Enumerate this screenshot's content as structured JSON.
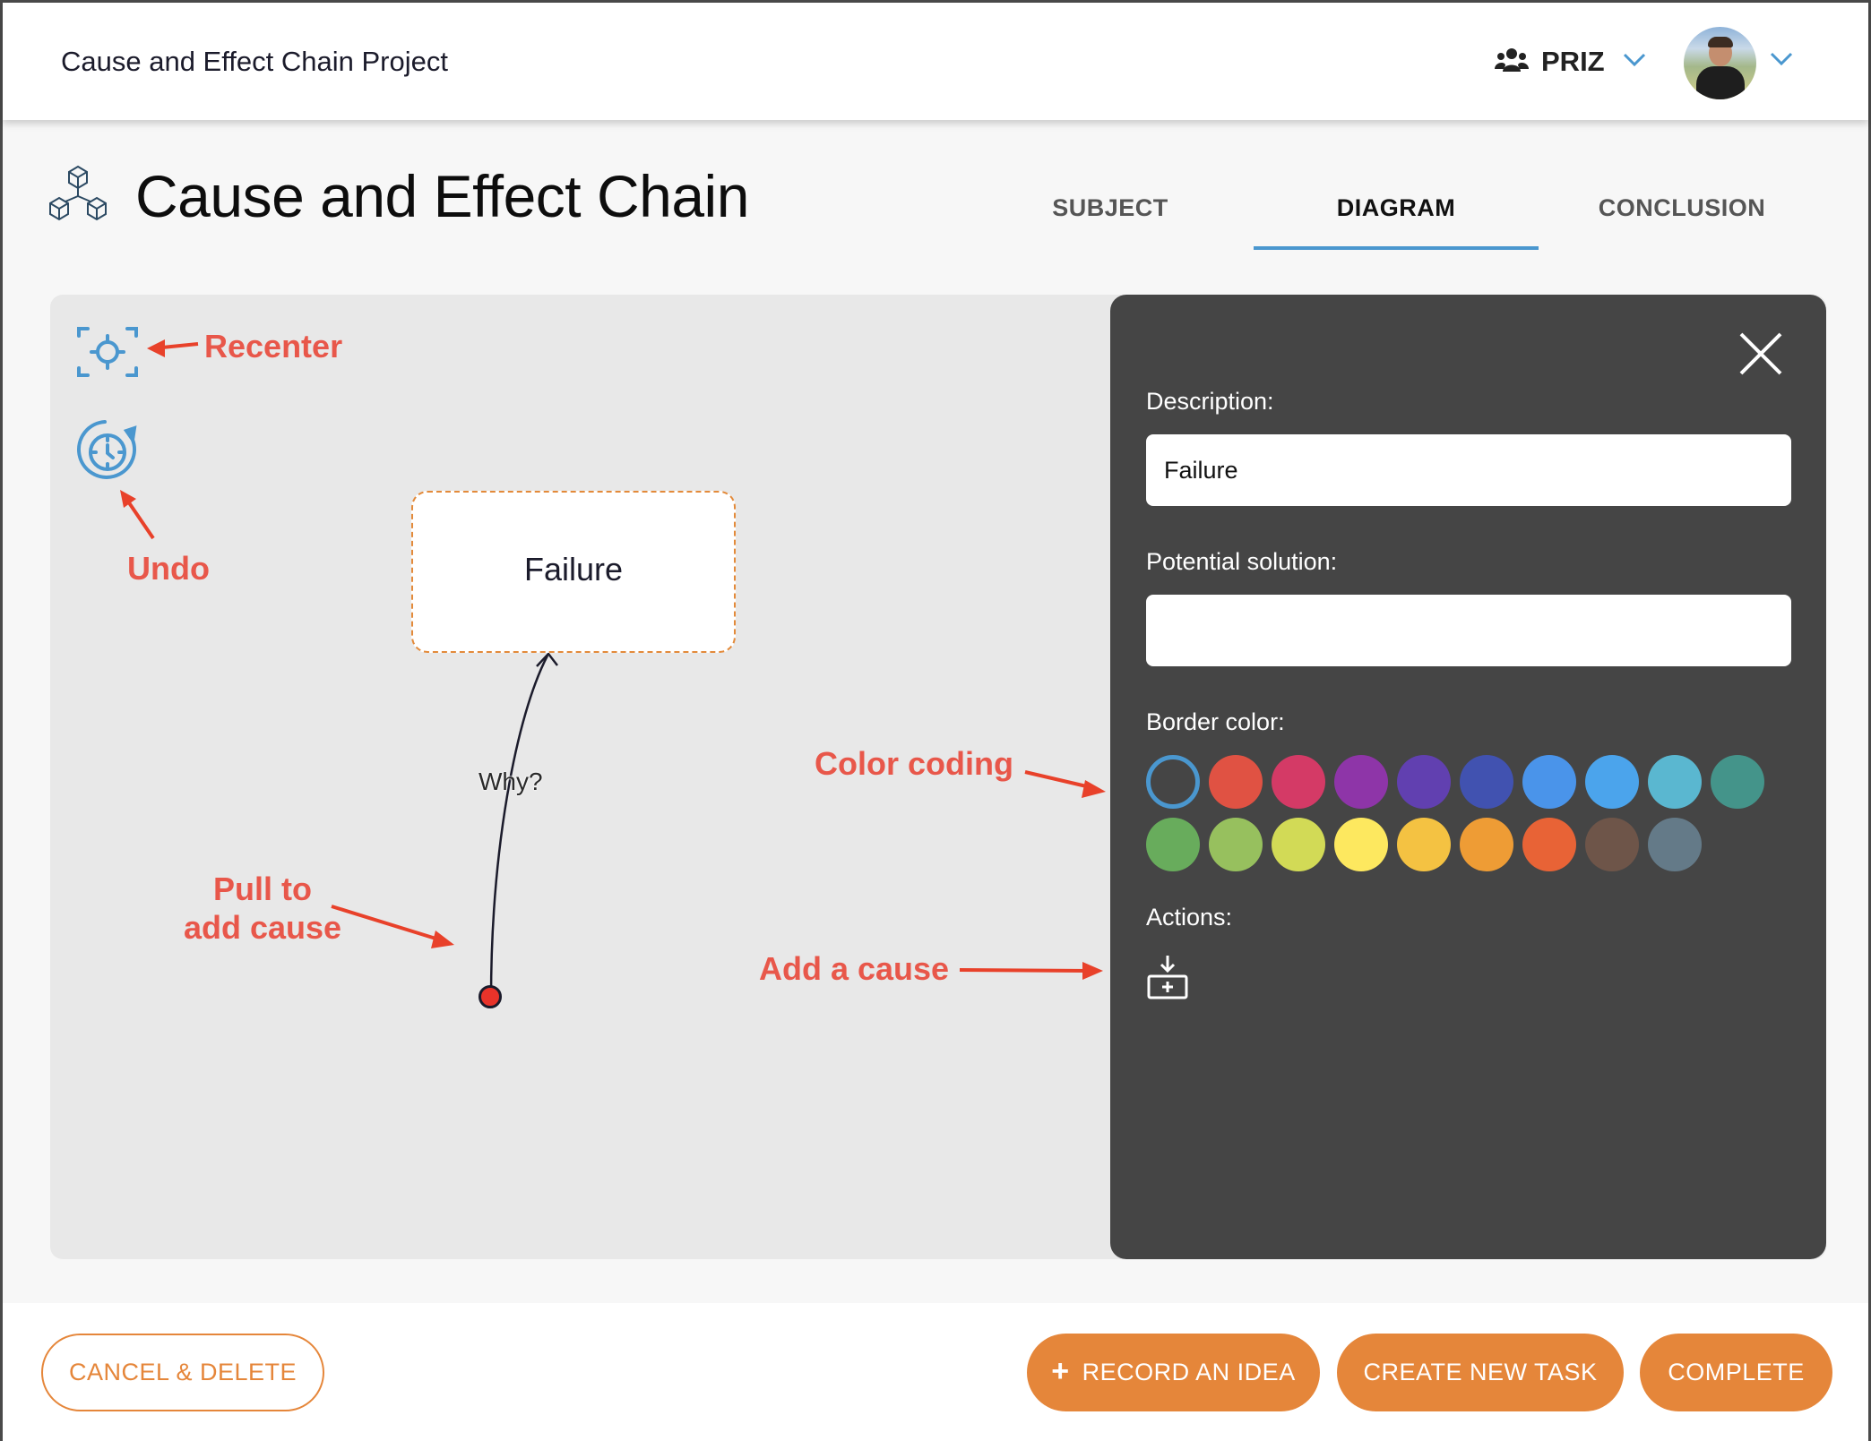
{
  "header": {
    "app_title": "Cause and Effect Chain Project",
    "team_label": "PRIZ",
    "team_icon": "users-icon",
    "user_avatar": "user-avatar"
  },
  "page": {
    "title": "Cause and Effect Chain",
    "icon": "cubes-icon"
  },
  "tabs": [
    {
      "label": "SUBJECT",
      "active": false
    },
    {
      "label": "DIAGRAM",
      "active": true
    },
    {
      "label": "CONCLUSION",
      "active": false
    }
  ],
  "canvas": {
    "tools": [
      {
        "name": "recenter",
        "icon": "recenter-icon"
      },
      {
        "name": "undo",
        "icon": "undo-history-icon"
      }
    ],
    "node": {
      "label": "Failure",
      "border_color": "#e38a3a"
    },
    "edge_label": "Why?",
    "annotations": {
      "recenter": "Recenter",
      "undo": "Undo",
      "pull_line1": "Pull to",
      "pull_line2": "add cause",
      "color_coding": "Color coding",
      "add_cause": "Add a cause"
    }
  },
  "panel": {
    "description_label": "Description:",
    "description_value": "Failure",
    "solution_label": "Potential solution:",
    "solution_value": "",
    "border_color_label": "Border color:",
    "colors": [
      "none",
      "#e05243",
      "#d43a66",
      "#8e35a8",
      "#6140b0",
      "#4152b0",
      "#4a94ea",
      "#4ba4ec",
      "#5ab7d0",
      "#44948a",
      "#68ac5c",
      "#97c05e",
      "#d2da56",
      "#fde85f",
      "#f4c242",
      "#ee9c35",
      "#e86336",
      "#6e5549",
      "#647a88"
    ],
    "selected_color_index": 0,
    "actions_label": "Actions:",
    "add_cause_icon": "add-cause-icon"
  },
  "footer": {
    "cancel_label": "CANCEL & DELETE",
    "record_label": "RECORD AN IDEA",
    "create_task_label": "CREATE NEW TASK",
    "complete_label": "COMPLETE"
  },
  "colors": {
    "accent_orange": "#e5863a",
    "accent_blue": "#4a97cf",
    "annotation_red": "#e8574a",
    "panel_bg": "#454545"
  }
}
